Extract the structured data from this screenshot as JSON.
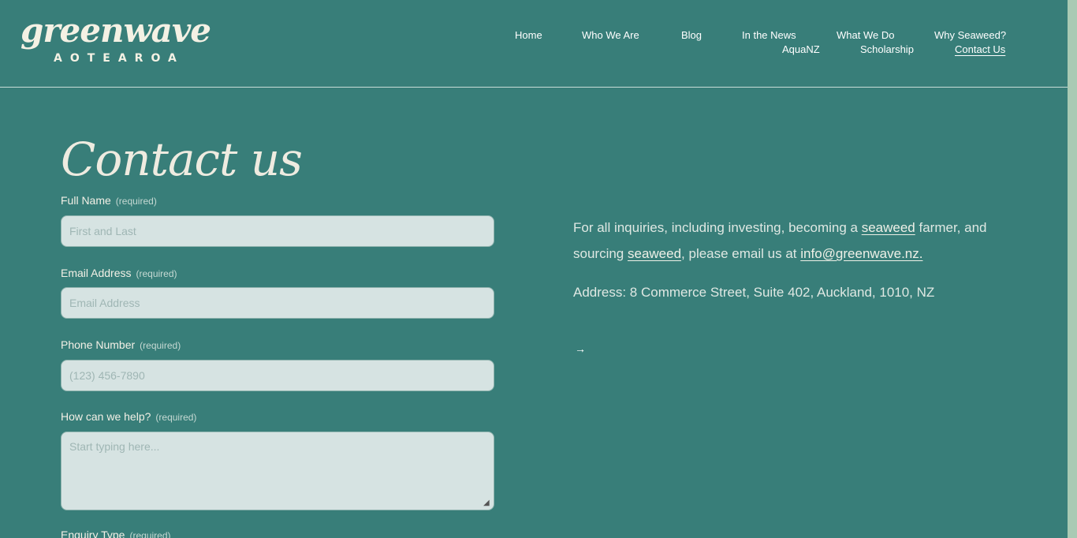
{
  "brand": {
    "logo_word": "greenwave",
    "logo_sub": "AOTEAROA"
  },
  "nav": {
    "items": [
      {
        "label": "Home"
      },
      {
        "label": "Who We Are"
      },
      {
        "label": "Blog"
      },
      {
        "label": "In the News"
      },
      {
        "label": "What We Do"
      },
      {
        "label": "Why Seaweed?"
      },
      {
        "label": "AquaNZ"
      },
      {
        "label": "Scholarship"
      },
      {
        "label": "Contact Us",
        "active": true
      }
    ]
  },
  "page": {
    "title": "Contact us"
  },
  "form": {
    "required_text": "(required)",
    "fields": [
      {
        "label": "Full Name",
        "placeholder": "First and Last"
      },
      {
        "label": "Email Address",
        "placeholder": "Email Address"
      },
      {
        "label": "Phone Number",
        "placeholder": "(123) 456-7890"
      },
      {
        "label": "How can we help?",
        "placeholder": "Start typing here..."
      },
      {
        "label": "Enquiry Type"
      }
    ]
  },
  "info": {
    "text_1": "For all inquiries, including investing, becoming a ",
    "link_1": "seaweed",
    "text_2": " farmer, and sourcing ",
    "link_2": "seaweed",
    "text_3": ", please email us at ",
    "email": "info@greenwave.nz.",
    "address": "Address: 8 Commerce Street, Suite 402, Auckland, 1010, NZ",
    "arrow": "→"
  },
  "colors": {
    "background": "#387e79",
    "input_bg": "#d6e3e2",
    "scroll_strip": "#a9cab4"
  }
}
